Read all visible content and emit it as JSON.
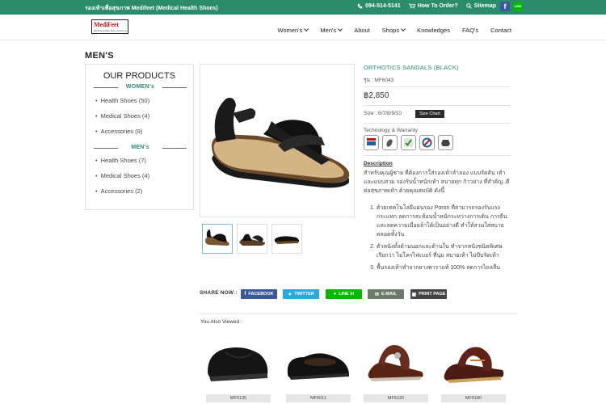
{
  "topbar": {
    "tagline": "รองเท้าเพื่อสุขภาพ Medifeet (Medical Health Shoes)",
    "phone": "094-514-5141",
    "how_to_order": "How To Order?",
    "sitemap": "Sitemap",
    "facebook_icon": "f",
    "line_icon": "LINE"
  },
  "header": {
    "logo_title": "MediFeet",
    "logo_sub": "Medical Health Shoe Solutions",
    "nav": [
      "Women's",
      "Men's",
      "About",
      "Shops",
      "Knowledges",
      "FAQ's",
      "Contact"
    ]
  },
  "page_title": "MEN'S",
  "sidebar": {
    "title": "OUR PRODUCTS",
    "women_label": "WOMEN's",
    "women_items": [
      "Health Shoes (50)",
      "Medical Shoes (4)",
      "Accessories (9)"
    ],
    "men_label": "MEN's",
    "men_items": [
      "Health Shoes (7)",
      "Medical Shoes (4)",
      "Accessories (2)"
    ]
  },
  "product": {
    "name": "ORTHOTICS SANDALS (BLACK)",
    "code": "รุ่น : MF6043",
    "price": "฿2,850",
    "size": "Size : 6/7/8/9/10",
    "size_chart": "Size Chart",
    "tech_label": "Technology & Warranty",
    "desc_label": "Description",
    "desc": "สำหรับคุณผู้ชาย ที่ต้องการใส่รองเท้าลำลอง แบบรัดส้น เท้าและแบบสวม รองรับน้ำหนักเท้า สบายทุก ก้าวย่าง ที่สำคัญ..ดีต่อสุขภาพเท้า ด้วยคุณสมบัติ ดังนี้",
    "bullets": [
      "ด้วยเทคโนโลยีแผ่นรอง Poron ที่สามารถรองรับแรงกระแทก ลดการสะท้อนน้ำหนักระหว่างการเดิน การยืน และลดความเมื่อยล้าได้เป็นอย่างดี ทำให้สวมใส่สบายตลอดทั้งวัน",
      "ตัวหนังทั้งด้านนอกและด้านใน ทำจากหนังชนิดพิเศษ เรียกว่า ไมโครไฟเบอร์ ที่นุ่ม สบายเท้า ไม่บีบรัดเท้า",
      "พื้นรองเท้าทำจากยางพาราแท้ 100% ลดการไถลลื่น"
    ]
  },
  "share": {
    "label": "SHARE NOW :",
    "facebook": "FACEBOOK",
    "twitter": "TWITTER",
    "line": "LINE it!",
    "email": "E-MAIL",
    "print": "PRINT PAGE"
  },
  "also_viewed": {
    "label": "You Also Viewed :",
    "items": [
      "MF6135",
      "MF6011",
      "MF5120",
      "MF5180"
    ]
  }
}
